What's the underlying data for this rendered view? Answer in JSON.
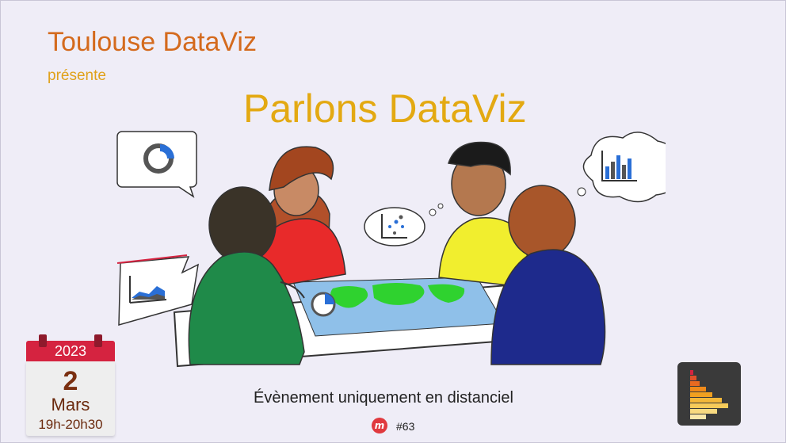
{
  "header": {
    "organizer": "Toulouse DataViz",
    "presents": "présente",
    "event_title": "Parlons DataViz"
  },
  "calendar": {
    "year": "2023",
    "day": "2",
    "month": "Mars",
    "time": "19h-20h30"
  },
  "footer": {
    "notice": "Évènement uniquement en distanciel",
    "meetup_tag": "#63"
  },
  "colors": {
    "orange": "#d46a1d",
    "gold": "#e3a912",
    "calendar_red": "#d52340"
  },
  "icons": [
    "donut-chart-icon",
    "scatter-chart-icon",
    "bar-chart-icon",
    "area-chart-icon",
    "pie-chart-icon",
    "meetup-icon",
    "histogram-logo-icon"
  ]
}
